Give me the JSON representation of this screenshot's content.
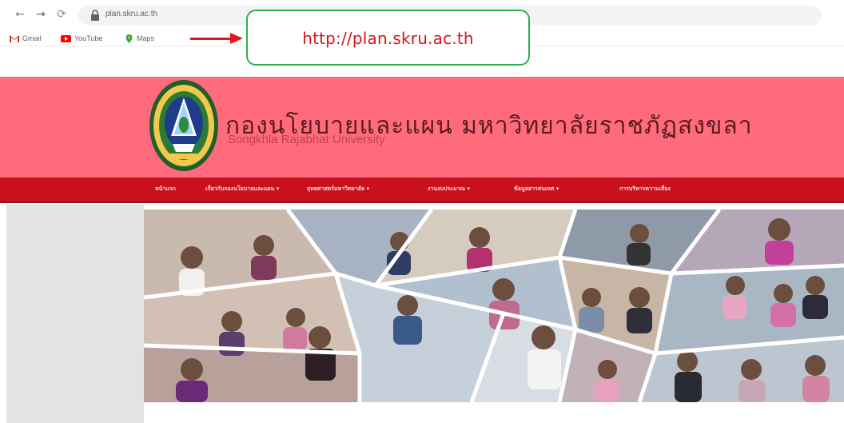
{
  "browser": {
    "url": "plan.skru.ac.th",
    "nav_icons": [
      "back-icon",
      "forward-icon",
      "reload-icon",
      "lock-icon"
    ],
    "bookmarks": [
      {
        "label": "Gmail",
        "icon": "gmail-icon"
      },
      {
        "label": "YouTube",
        "icon": "youtube-icon"
      },
      {
        "label": "Maps",
        "icon": "maps-icon"
      }
    ]
  },
  "callout": {
    "text": "http://plan.skru.ac.th",
    "border_color": "#2fb04a",
    "text_color": "#d4161c",
    "arrow_color": "#e3161b"
  },
  "site": {
    "title_th": "กองนโยบายและแผน มหาวิทยาลัยราชภัฏสงขลา",
    "title_en": "Songkhla Rajabhat University",
    "header_color": "#ff6b7c",
    "menu_color": "#c8101e",
    "menu": [
      {
        "label": "หน้าแรก"
      },
      {
        "label": "เกี่ยวกับกองนโยบายและแผน ▾"
      },
      {
        "label": "ยุทธศาสตร์มหาวิทยาลัย ▾"
      },
      {
        "label": "งานงบประมาณ ▾"
      },
      {
        "label": "ข้อมูลสารสนเทศ ▾"
      },
      {
        "label": "การบริหารความเสี่ยง"
      }
    ]
  }
}
